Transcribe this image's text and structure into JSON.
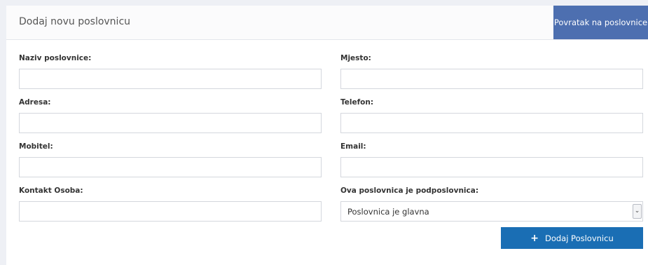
{
  "header": {
    "title": "Dodaj novu poslovnicu",
    "back_button": "Povratak na poslovnice"
  },
  "form": {
    "fields": [
      {
        "label": "Naziv poslovnice:",
        "value": ""
      },
      {
        "label": "Mjesto:",
        "value": ""
      },
      {
        "label": "Adresa:",
        "value": ""
      },
      {
        "label": "Telefon:",
        "value": ""
      },
      {
        "label": "Mobitel:",
        "value": ""
      },
      {
        "label": "Email:",
        "value": ""
      },
      {
        "label": "Kontakt Osoba:",
        "value": ""
      },
      {
        "label": "Ova poslovnica je podposlovnica:",
        "value": "Poslovnica je glavna"
      }
    ],
    "submit_label": "Dodaj Poslovnicu",
    "submit_icon": "plus-icon"
  },
  "colors": {
    "back_button": "#4d6fb0",
    "submit_button": "#1a6eb4"
  }
}
